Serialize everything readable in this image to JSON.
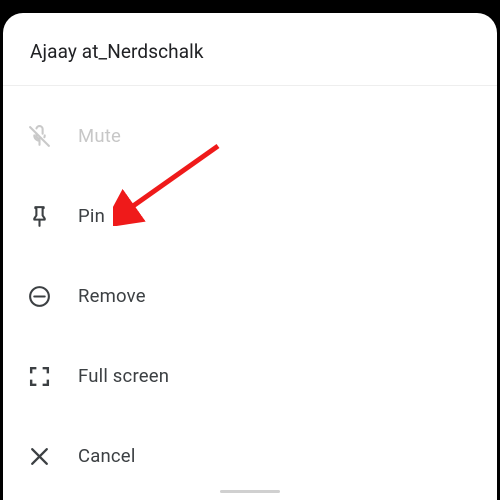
{
  "header": {
    "title": "Ajaay at_Nerdschalk"
  },
  "menu": {
    "mute": {
      "label": "Mute"
    },
    "pin": {
      "label": "Pin"
    },
    "remove": {
      "label": "Remove"
    },
    "fullscreen": {
      "label": "Full screen"
    },
    "cancel": {
      "label": "Cancel"
    }
  }
}
